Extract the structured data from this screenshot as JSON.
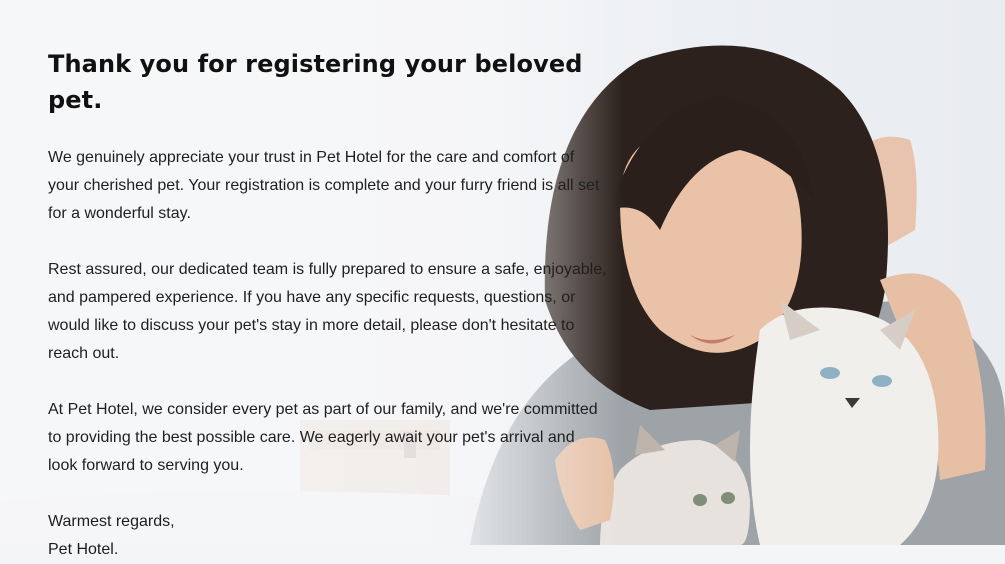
{
  "heading": "Thank you for registering your beloved pet.",
  "paragraphs": [
    "We genuinely appreciate your trust in Pet Hotel for the care and comfort of your cherished pet. Your registration is complete and your furry friend is all set for a wonderful stay.",
    "Rest assured, our dedicated team is fully prepared to ensure a safe, enjoyable, and pampered experience. If you have any specific requests, questions, or would like to discuss your pet's stay in more detail, please don't hesitate to reach out.",
    "At Pet Hotel, we consider every pet as part of our family, and we're committed to providing the best possible care. We eagerly await your pet's arrival and look forward to serving you."
  ],
  "closing": "Warmest regards,",
  "signature": "Pet Hotel."
}
